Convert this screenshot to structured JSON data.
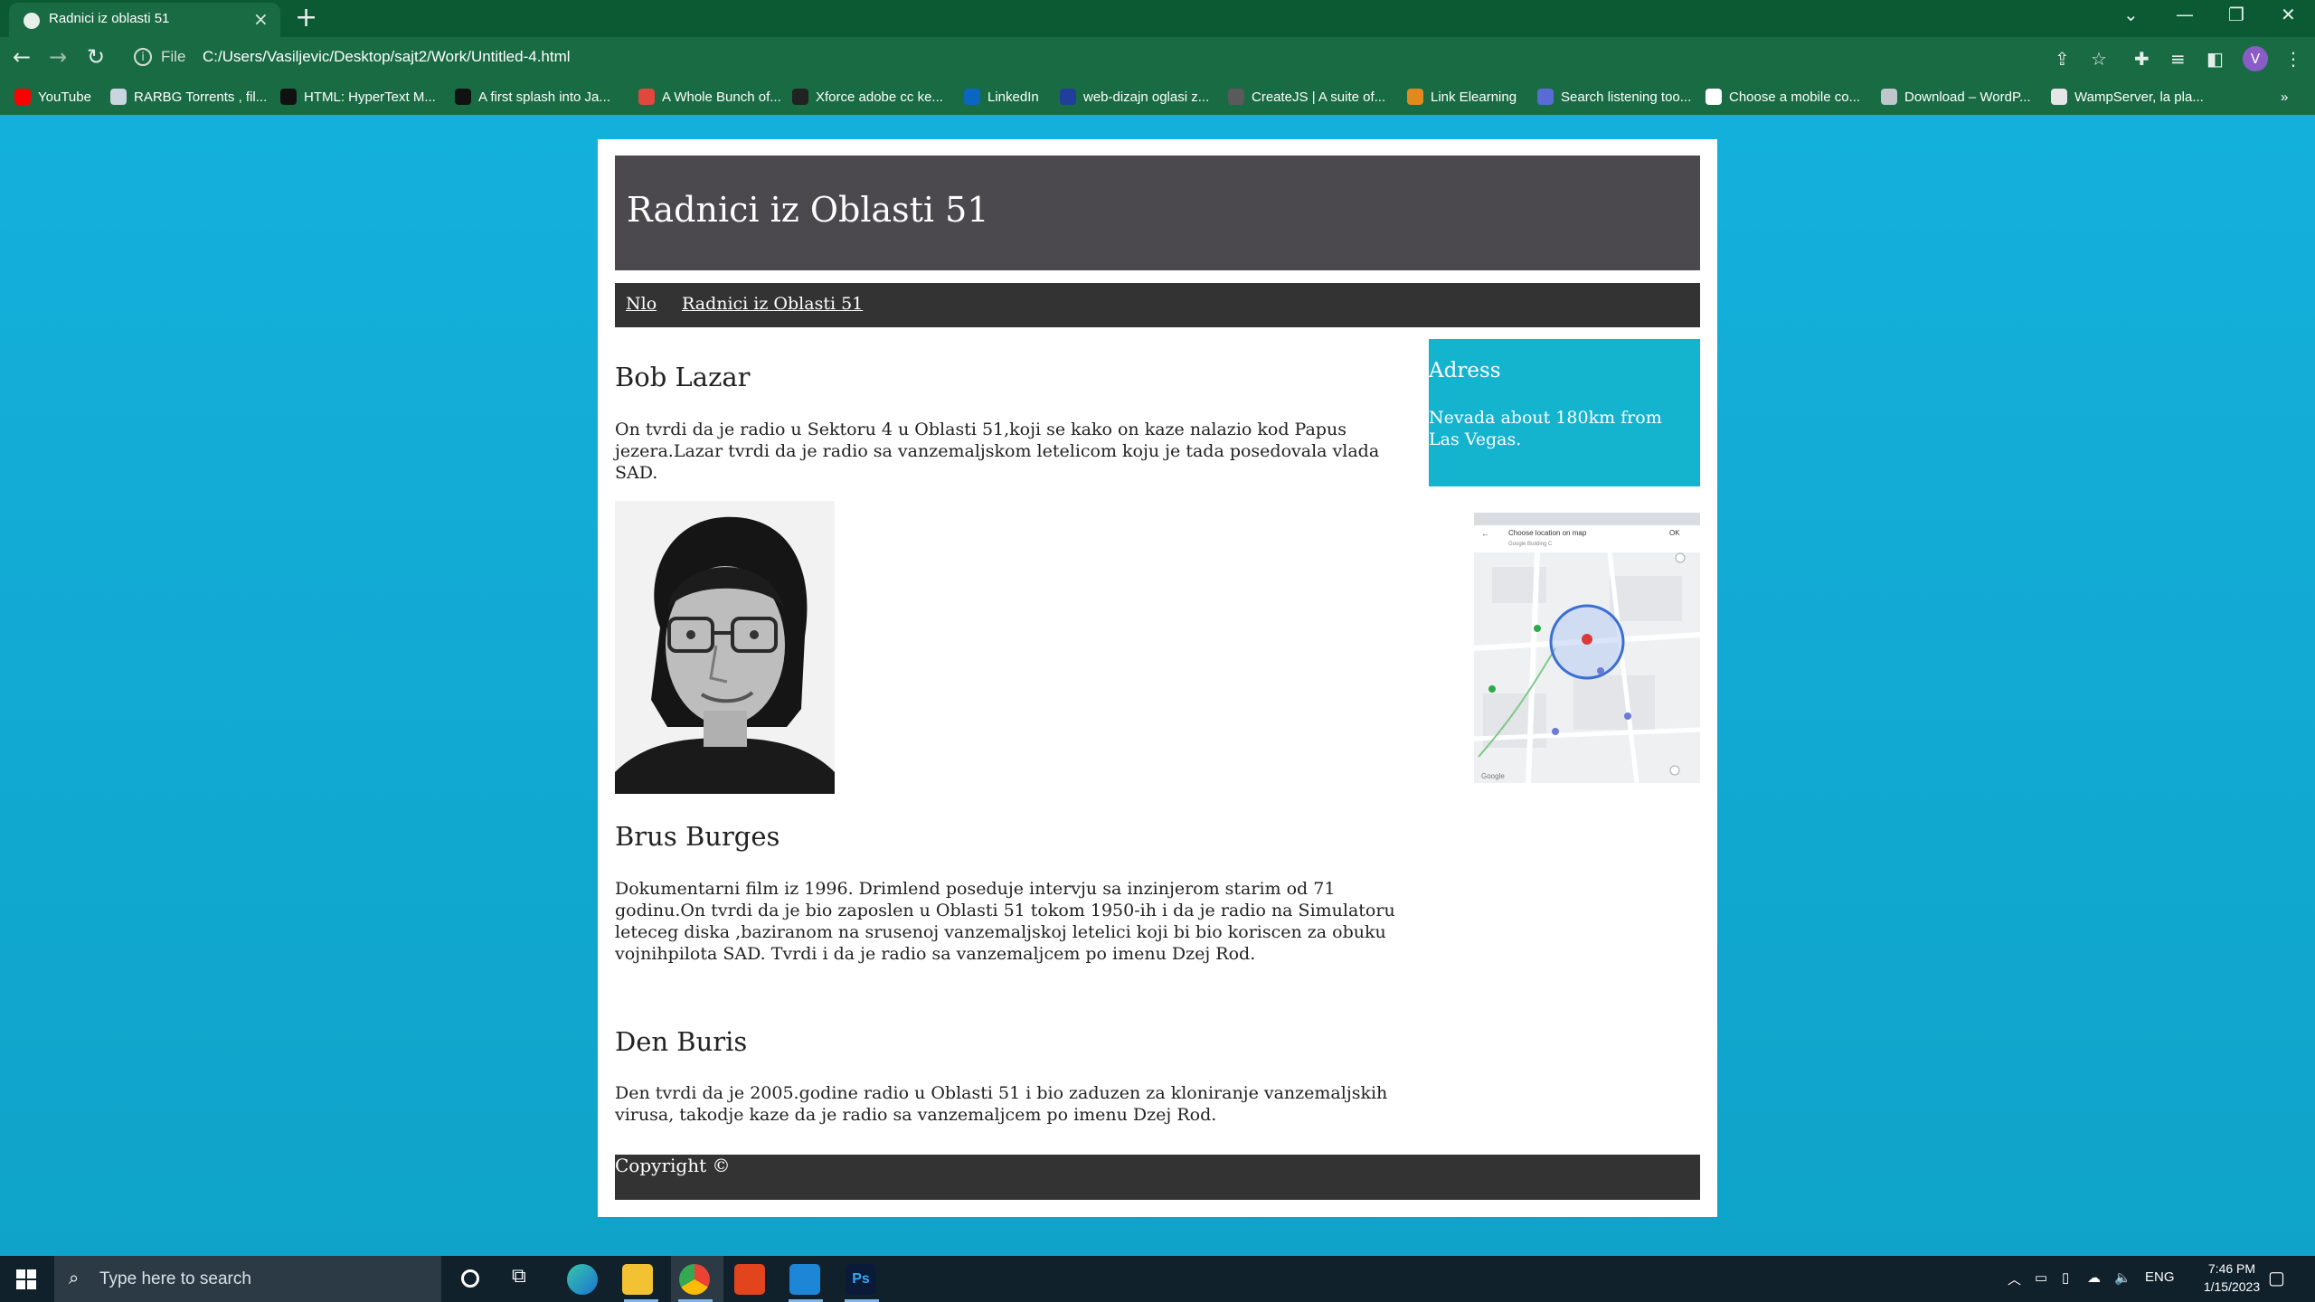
{
  "browser": {
    "tab_title": "Radnici iz oblasti 51",
    "tab_close": "×",
    "new_tab": "+",
    "address_prefix": "File",
    "address_url": "C:/Users/Vasiljevic/Desktop/sajt2/Work/Untitled-4.html",
    "profile_initial": "V",
    "bookmarks": [
      {
        "label": "YouTube",
        "color": "#ff0000"
      },
      {
        "label": "RARBG Torrents , fil...",
        "color": "#c9d6de"
      },
      {
        "label": "HTML: HyperText M...",
        "color": "#111111"
      },
      {
        "label": "A first splash into Ja...",
        "color": "#111111"
      },
      {
        "label": "A Whole Bunch of...",
        "color": "#e0483d"
      },
      {
        "label": "Xforce adobe cc ke...",
        "color": "#222222"
      },
      {
        "label": "LinkedIn",
        "color": "#0a66c2"
      },
      {
        "label": "web-dizajn oglasi z...",
        "color": "#1f3f9a"
      },
      {
        "label": "CreateJS | A suite of...",
        "color": "#5a5a5a"
      },
      {
        "label": "Link Elearning",
        "color": "#e08a1e"
      },
      {
        "label": "Search listening too...",
        "color": "#5a6bd8"
      },
      {
        "label": "Choose a mobile co...",
        "color": "#ffffff"
      },
      {
        "label": "Download – WordP...",
        "color": "#bfc7cc"
      },
      {
        "label": "WampServer, la pla...",
        "color": "#e6e6e6"
      }
    ],
    "bookmarks_more": "»"
  },
  "site": {
    "header_title": "Radnici iz Oblasti 51",
    "nav": [
      "Nlo",
      "Radnici iz Oblasti 51"
    ],
    "articles": [
      {
        "name": "Bob Lazar",
        "text": "On tvrdi da je radio u Sektoru 4 u Oblasti 51,koji se kako on kaze nalazio kod Papus jezera.Lazar tvrdi da je radio sa vanzemaljskom letelicom koju je tada posedovala vlada SAD."
      },
      {
        "name": "Brus Burges",
        "text": "Dokumentarni film iz 1996. Drimlend poseduje intervju sa inzinjerom starim od 71 godinu.On tvrdi da je bio zaposlen u Oblasti 51 tokom 1950-ih i da je radio na Simulatoru leteceg diska ,baziranom na srusenoj vanzemaljskoj letelici koji bi bio koriscen za obuku vojnihpilota SAD. Tvrdi i da je radio sa vanzemaljcem po imenu Dzej Rod."
      },
      {
        "name": "Den Buris",
        "text": "Den tvrdi da je 2005.godine radio u Oblasti 51 i bio zaduzen za kloniranje vanzemaljskih virusa, takodje kaze da je radio sa vanzemaljcem po imenu Dzej Rod."
      }
    ],
    "aside_title": "Adress",
    "aside_text": "Nevada about 180km from Las Vegas.",
    "map_header": "Choose location on map",
    "map_sub": "Google Building C",
    "map_ok": "OK",
    "map_brand": "Google",
    "footer": "Copyright ©"
  },
  "taskbar": {
    "search_placeholder": "Type here to search",
    "lang": "ENG",
    "time": "7:46 PM",
    "date": "1/15/2023"
  },
  "colors": {
    "page_bg": "#15a6cc",
    "header_bg": "#4b484e",
    "nav_bg": "#333333",
    "aside_bg": "#14b4cf",
    "browser_chrome": "#196b44"
  }
}
